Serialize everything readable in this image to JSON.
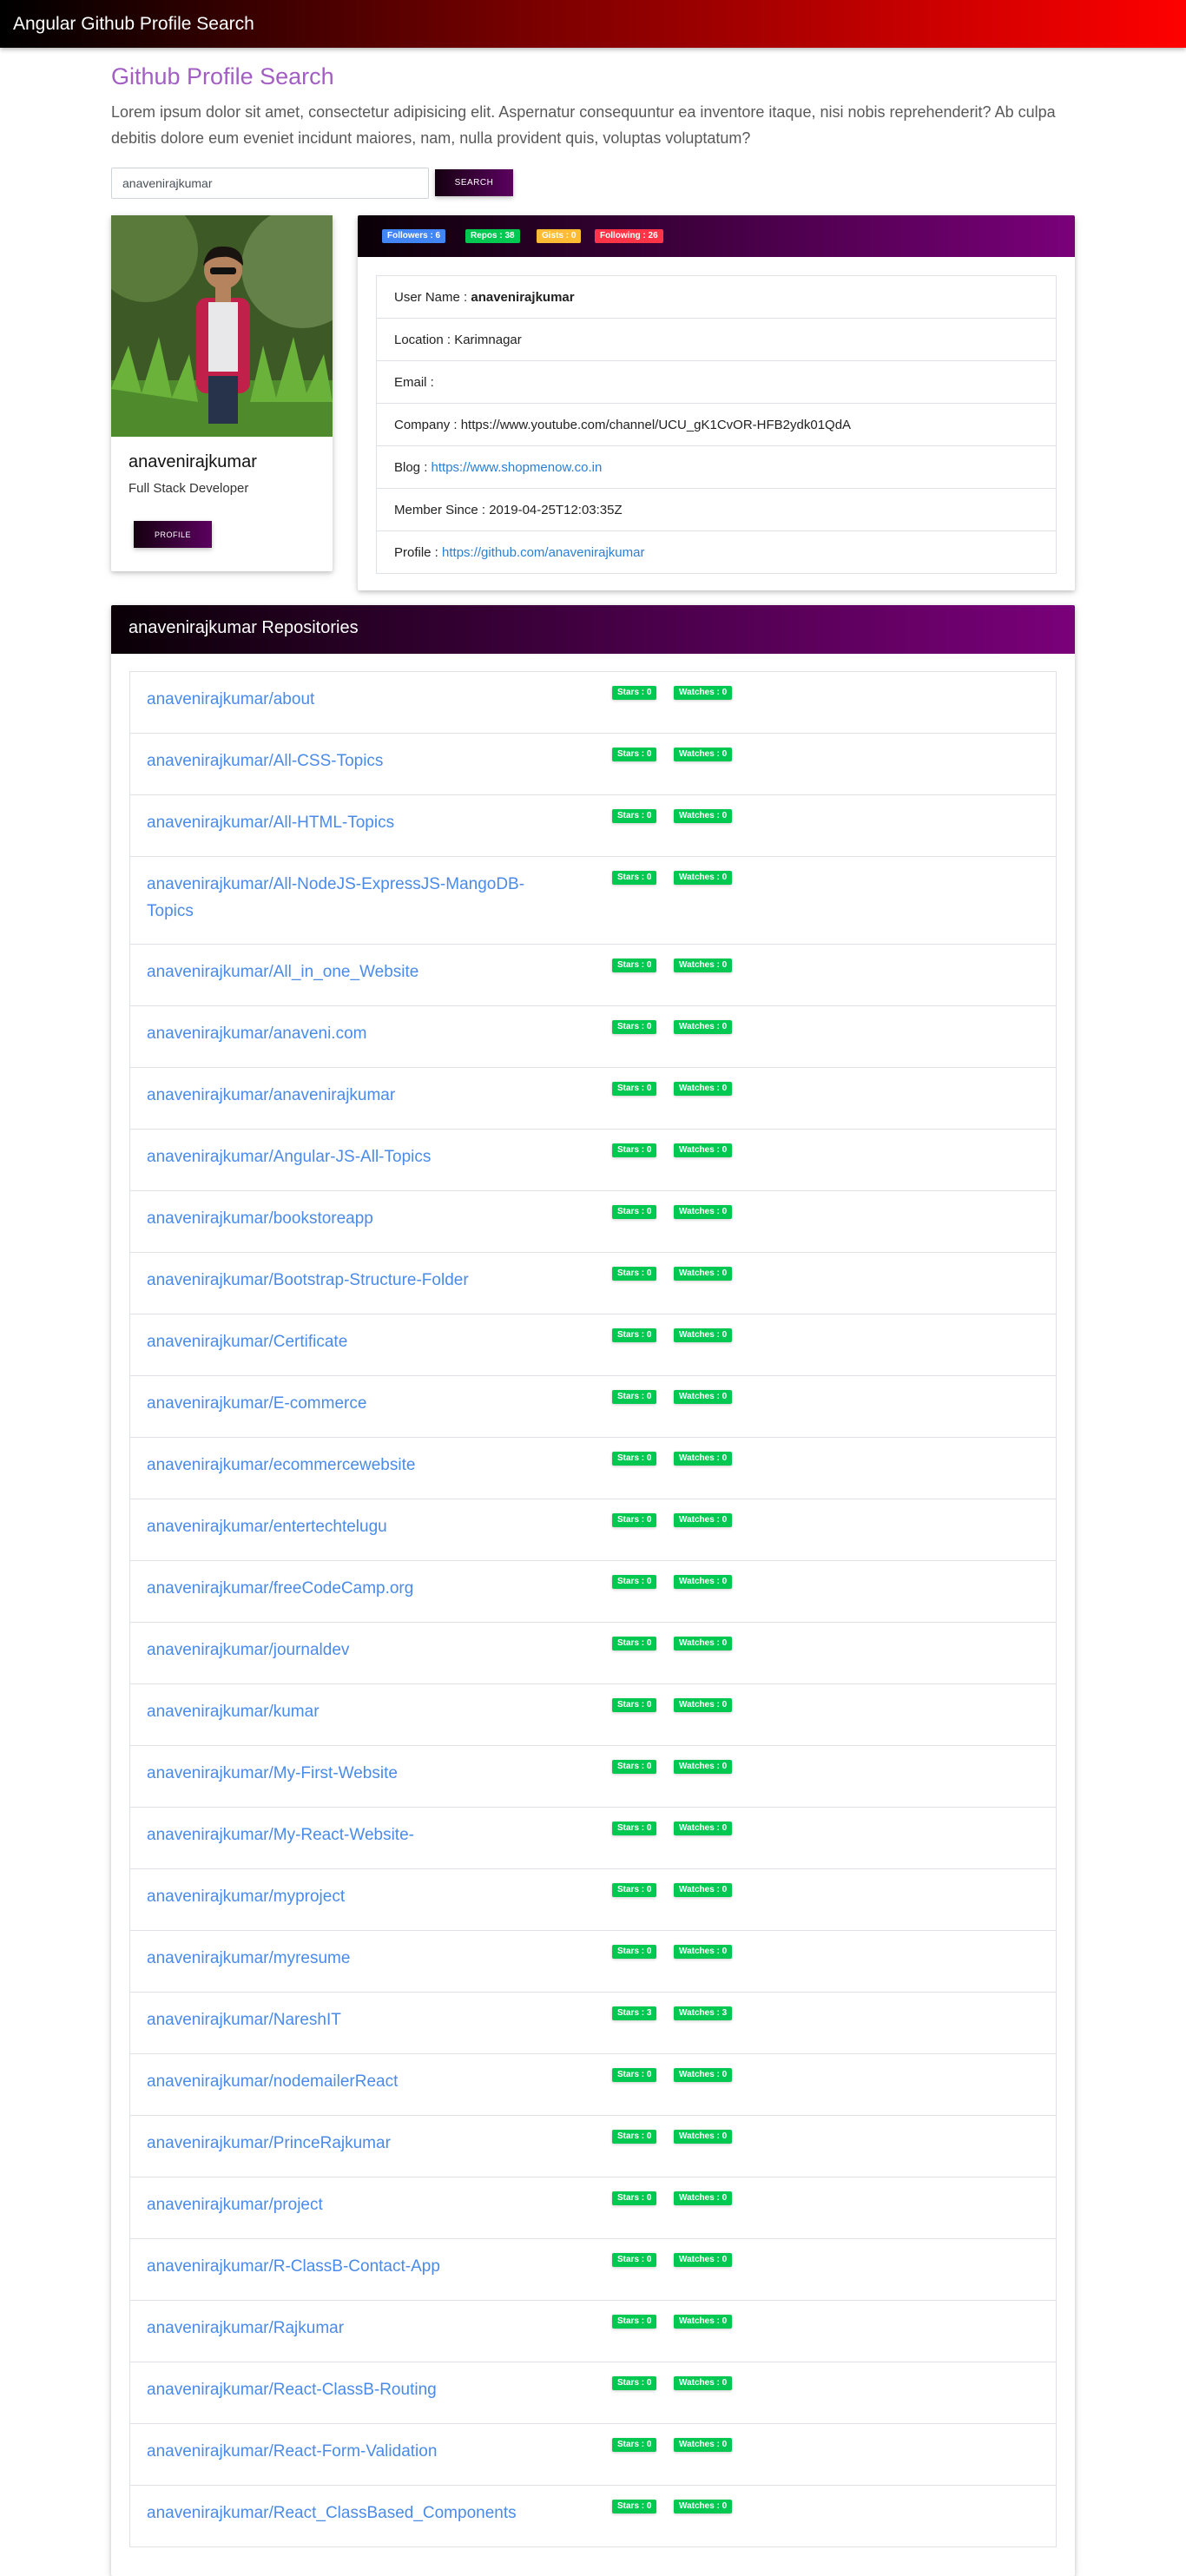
{
  "app": {
    "title": "Angular Github Profile Search"
  },
  "header": {
    "title": "Github Profile Search",
    "intro": "Lorem ipsum dolor sit amet, consectetur adipisicing elit. Aspernatur consequuntur ea inventore itaque, nisi nobis reprehenderit? Ab culpa debitis dolore eum eveniet incidunt maiores, nam, nulla provident quis, voluptas voluptatum?"
  },
  "search": {
    "value": "anavenirajkumar",
    "button_label": "SEARCH"
  },
  "profile": {
    "name": "anavenirajkumar",
    "role": "Full Stack Developer",
    "button_label": "PROFILE"
  },
  "badges": {
    "followers": "Followers : 6",
    "repos": "Repos : 38",
    "gists": "Gists : 0",
    "following": "Following : 26"
  },
  "colors": {
    "followers": "#4285f4",
    "repos": "#00c851",
    "gists": "#ffbb33",
    "following": "#ff3547",
    "accent": "#a35ec4",
    "link": "#4a8be8"
  },
  "details": {
    "username_label": "User Name : ",
    "username": "anavenirajkumar",
    "location": "Location : Karimnagar",
    "email": "Email :",
    "company": "Company : https://www.youtube.com/channel/UCU_gK1CvOR-HFB2ydk01QdA",
    "blog_label": "Blog : ",
    "blog_url": "https://www.shopmenow.co.in",
    "member_since": "Member Since : 2019-04-25T12:03:35Z",
    "profile_label": "Profile : ",
    "profile_url": "https://github.com/anavenirajkumar"
  },
  "repos": {
    "title": "anavenirajkumar Repositories",
    "items": [
      {
        "name": "anavenirajkumar/about",
        "stars": "Stars : 0",
        "watches": "Watches : 0"
      },
      {
        "name": "anavenirajkumar/All-CSS-Topics",
        "stars": "Stars : 0",
        "watches": "Watches : 0"
      },
      {
        "name": "anavenirajkumar/All-HTML-Topics",
        "stars": "Stars : 0",
        "watches": "Watches : 0"
      },
      {
        "name": "anavenirajkumar/All-NodeJS-ExpressJS-MangoDB-Topics",
        "stars": "Stars : 0",
        "watches": "Watches : 0",
        "wrap": true
      },
      {
        "name": "anavenirajkumar/All_in_one_Website",
        "stars": "Stars : 0",
        "watches": "Watches : 0"
      },
      {
        "name": "anavenirajkumar/anaveni.com",
        "stars": "Stars : 0",
        "watches": "Watches : 0"
      },
      {
        "name": "anavenirajkumar/anavenirajkumar",
        "stars": "Stars : 0",
        "watches": "Watches : 0"
      },
      {
        "name": "anavenirajkumar/Angular-JS-All-Topics",
        "stars": "Stars : 0",
        "watches": "Watches : 0"
      },
      {
        "name": "anavenirajkumar/bookstoreapp",
        "stars": "Stars : 0",
        "watches": "Watches : 0"
      },
      {
        "name": "anavenirajkumar/Bootstrap-Structure-Folder",
        "stars": "Stars : 0",
        "watches": "Watches : 0"
      },
      {
        "name": "anavenirajkumar/Certificate",
        "stars": "Stars : 0",
        "watches": "Watches : 0"
      },
      {
        "name": "anavenirajkumar/E-commerce",
        "stars": "Stars : 0",
        "watches": "Watches : 0"
      },
      {
        "name": "anavenirajkumar/ecommercewebsite",
        "stars": "Stars : 0",
        "watches": "Watches : 0"
      },
      {
        "name": "anavenirajkumar/entertechtelugu",
        "stars": "Stars : 0",
        "watches": "Watches : 0"
      },
      {
        "name": "anavenirajkumar/freeCodeCamp.org",
        "stars": "Stars : 0",
        "watches": "Watches : 0"
      },
      {
        "name": "anavenirajkumar/journaldev",
        "stars": "Stars : 0",
        "watches": "Watches : 0"
      },
      {
        "name": "anavenirajkumar/kumar",
        "stars": "Stars : 0",
        "watches": "Watches : 0"
      },
      {
        "name": "anavenirajkumar/My-First-Website",
        "stars": "Stars : 0",
        "watches": "Watches : 0"
      },
      {
        "name": "anavenirajkumar/My-React-Website-",
        "stars": "Stars : 0",
        "watches": "Watches : 0"
      },
      {
        "name": "anavenirajkumar/myproject",
        "stars": "Stars : 0",
        "watches": "Watches : 0"
      },
      {
        "name": "anavenirajkumar/myresume",
        "stars": "Stars : 0",
        "watches": "Watches : 0"
      },
      {
        "name": "anavenirajkumar/NareshIT",
        "stars": "Stars : 3",
        "watches": "Watches : 3"
      },
      {
        "name": "anavenirajkumar/nodemailerReact",
        "stars": "Stars : 0",
        "watches": "Watches : 0"
      },
      {
        "name": "anavenirajkumar/PrinceRajkumar",
        "stars": "Stars : 0",
        "watches": "Watches : 0"
      },
      {
        "name": "anavenirajkumar/project",
        "stars": "Stars : 0",
        "watches": "Watches : 0"
      },
      {
        "name": "anavenirajkumar/R-ClassB-Contact-App",
        "stars": "Stars : 0",
        "watches": "Watches : 0"
      },
      {
        "name": "anavenirajkumar/Rajkumar",
        "stars": "Stars : 0",
        "watches": "Watches : 0"
      },
      {
        "name": "anavenirajkumar/React-ClassB-Routing",
        "stars": "Stars : 0",
        "watches": "Watches : 0"
      },
      {
        "name": "anavenirajkumar/React-Form-Validation",
        "stars": "Stars : 0",
        "watches": "Watches : 0"
      },
      {
        "name": "anavenirajkumar/React_ClassBased_Components",
        "stars": "Stars : 0",
        "watches": "Watches : 0"
      }
    ]
  }
}
